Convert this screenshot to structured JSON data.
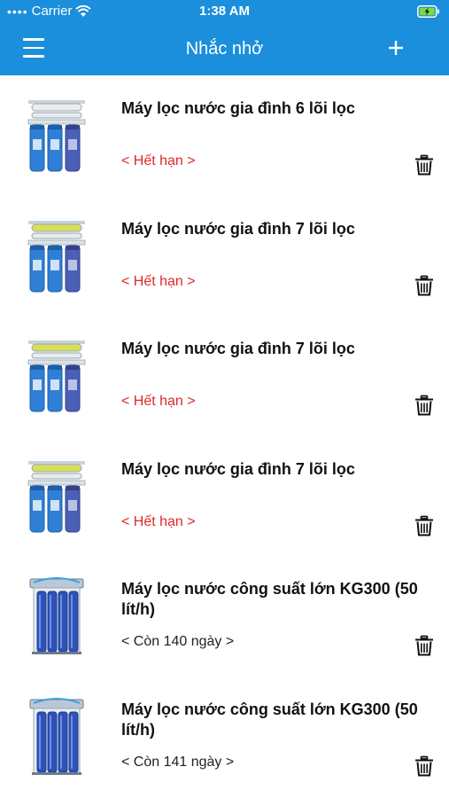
{
  "status_bar": {
    "carrier": "Carrier",
    "time": "1:38 AM"
  },
  "nav": {
    "title": "Nhắc nhở"
  },
  "reminders": [
    {
      "name": "Máy lọc nước gia đình 6 lõi lọc",
      "status": "< Hết hạn >",
      "state": "expired",
      "image": "water-filter-6-stage"
    },
    {
      "name": "Máy lọc nước gia đình 7 lõi lọc",
      "status": "< Hết hạn >",
      "state": "expired",
      "image": "water-filter-7-stage"
    },
    {
      "name": "Máy lọc nước gia đình 7 lõi lọc",
      "status": "< Hết hạn >",
      "state": "expired",
      "image": "water-filter-7-stage"
    },
    {
      "name": "Máy lọc nước gia đình 7 lõi lọc",
      "status": "< Hết hạn >",
      "state": "expired",
      "image": "water-filter-7-stage"
    },
    {
      "name": "Máy lọc nước công suất lớn KG300 (50 lít/h)",
      "status": "< Còn 140 ngày >",
      "state": "remaining",
      "image": "water-filter-kg300"
    },
    {
      "name": "Máy lọc nước công suất lớn KG300 (50 lít/h)",
      "status": "< Còn 141 ngày >",
      "state": "remaining",
      "image": "water-filter-kg300"
    }
  ],
  "colors": {
    "header": "#1b8fdc",
    "expired": "#e02828",
    "remaining": "#222222"
  }
}
